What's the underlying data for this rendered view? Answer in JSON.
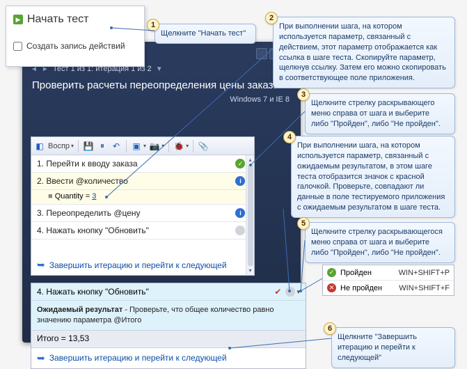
{
  "start_card": {
    "title": "Начать тест",
    "checkbox_label": "Создать запись действий"
  },
  "callouts": {
    "1": "Щелкните \"Начать тест\"",
    "2": "При выполнении шага, на котором используется параметр, связанный с действием, этот параметр отображается как ссылка в шаге теста. Скопируйте параметр, щелкнув ссылку. Затем его можно скопировать в соответствующее поле приложения.",
    "3": "Щелкните стрелку раскрывающего меню справа от шага и выберите либо \"Пройден\", либо \"Не пройден\".",
    "4": "При выполнении шага, на котором используется параметр, связанный с ожидаемым результатом, в этом шаге теста отобразится значок с красной галочкой. Проверьте, совпадают ли данные в поле тестируемого приложения с ожидаемым результатом в шаге теста.",
    "5": "Щелкните стрелку раскрывающегося меню справа от шага и выберите либо \"Пройден\", либо \"Не пройден\".",
    "6": "Щелкните \"Завершить итерацию и перейти к следующей\""
  },
  "app": {
    "iteration_label": "Тест 1 из 1: итерация 1 из 2",
    "test_title": "Проверить расчеты переопределения цены заказа",
    "env_label": "Windows 7 и IE 8"
  },
  "toolbar": {
    "vosp_label": "Воспр"
  },
  "steps": [
    {
      "num": "1.",
      "text": "Перейти к вводу заказа",
      "status": "pass"
    },
    {
      "num": "2.",
      "text": "Ввести @количество",
      "status": "info",
      "selected": true,
      "sub_label": "Quantity =",
      "sub_link": "3"
    },
    {
      "num": "3.",
      "text": "Переопределить @цену",
      "status": "info"
    },
    {
      "num": "4.",
      "text": "Нажать кнопку \"Обновить\"",
      "status": "none"
    }
  ],
  "finish_link": "Завершить итерацию и перейти к следующей",
  "expanded": {
    "head": "4. Нажать кнопку \"Обновить\"",
    "expected_label": "Ожидаемый результат",
    "expected_text": " - Проверьте, что общее количество равно значению параметра @Итого",
    "itogo": "Итого = 13,53",
    "finish_link": "Завершить итерацию и перейти к следующей"
  },
  "shortcuts": {
    "pass_label": "Пройден",
    "pass_key": "WIN+SHIFT+P",
    "fail_label": "Не пройден",
    "fail_key": "WIN+SHIFT+F"
  }
}
